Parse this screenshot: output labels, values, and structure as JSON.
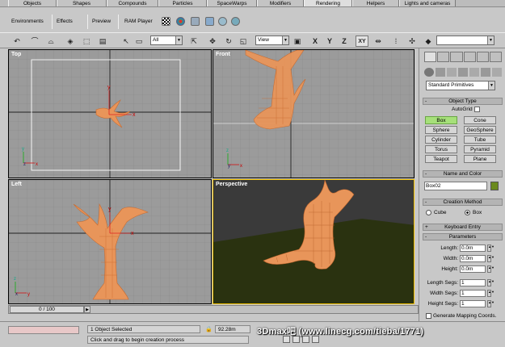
{
  "tabs_top": [
    "Objects",
    "Shapes",
    "Compounds",
    "Particles",
    "SpaceWarps",
    "Modifiers",
    "Rendering",
    "Helpers",
    "Lights and cameras"
  ],
  "tabs_row2": [
    "Environments",
    "Effects",
    "Preview",
    "RAM Player"
  ],
  "toolbar": {
    "selection_filter": "All",
    "coord_system": "View",
    "axis_x": "X",
    "axis_y": "Y",
    "axis_z": "Z",
    "axis_xy": "XY"
  },
  "viewports": {
    "top": "Top",
    "front": "Front",
    "left": "Left",
    "perspective": "Perspective"
  },
  "command_panel": {
    "category": "Standard Primitives",
    "object_type": "Object Type",
    "autogrid": "AutoGrid",
    "buttons": [
      "Box",
      "Cone",
      "Sphere",
      "GeoSphere",
      "Cylinder",
      "Tube",
      "Torus",
      "Pyramid",
      "Teapot",
      "Plane"
    ],
    "name_and_color": "Name and Color",
    "object_name": "Box02",
    "object_color": "#6b8a1e",
    "creation_method": "Creation Method",
    "cube": "Cube",
    "box": "Box",
    "keyboard_entry": "Keyboard Entry",
    "parameters": "Parameters",
    "length_label": "Length:",
    "length": "0.0m",
    "width_label": "Width:",
    "width": "0.0m",
    "height_label": "Height:",
    "height": "0.0m",
    "length_segs_label": "Length Segs:",
    "length_segs": "1",
    "width_segs_label": "Width Segs:",
    "width_segs": "1",
    "height_segs_label": "Height Segs:",
    "height_segs": "1",
    "mapping": "Generate Mapping Coords."
  },
  "timeline": {
    "frame": "0 / 100"
  },
  "status": {
    "selected": "1 Object Selected",
    "prompt": "Click and drag to begin creation process",
    "coord": "92.28m"
  },
  "watermark": "3Dmax吧 (www.linecg.com/tieba/1771)",
  "colors": {
    "tree": "#e8955a",
    "ground": "#2a3210",
    "sky": "#3a3a3a"
  }
}
